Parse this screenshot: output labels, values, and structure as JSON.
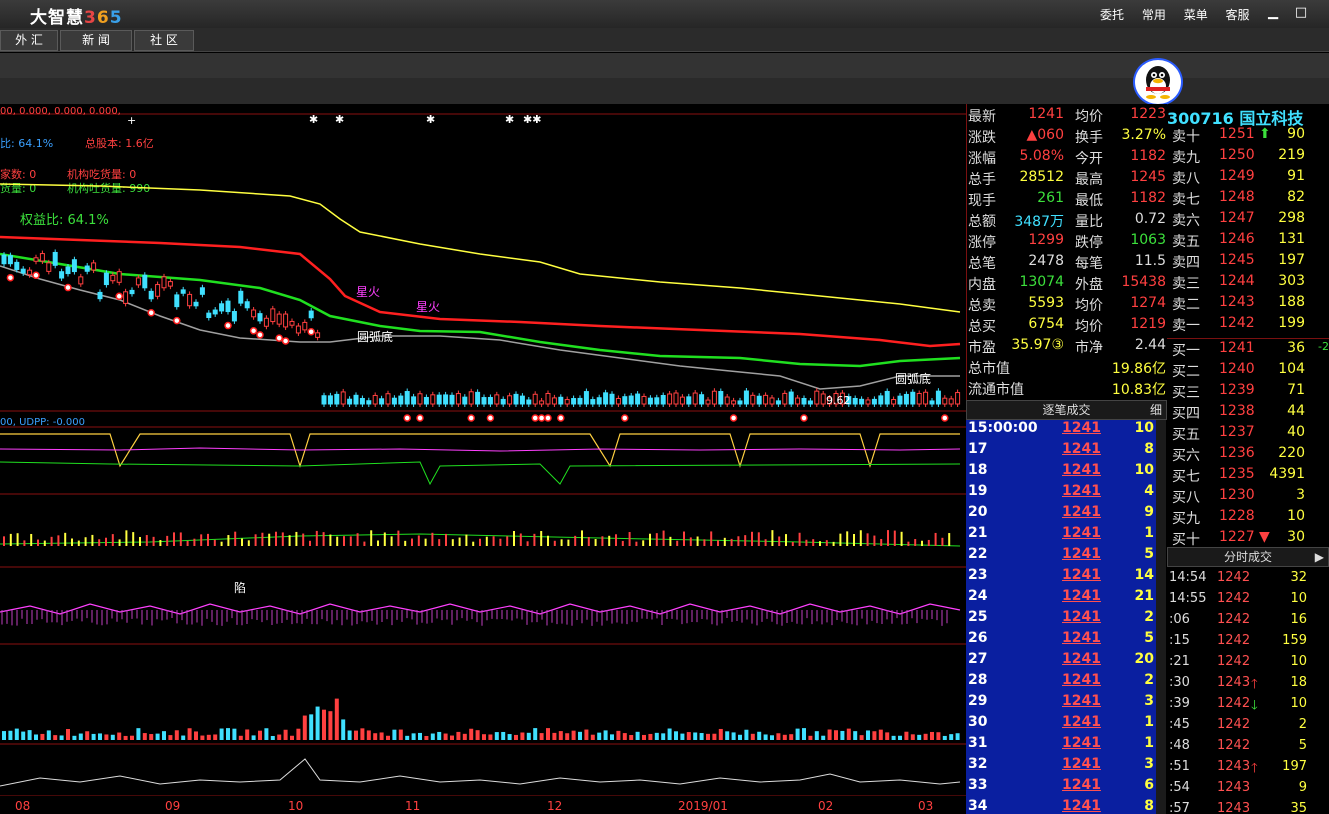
{
  "app": {
    "logo_main": "大智慧",
    "logo_3": "3",
    "logo_6": "6",
    "logo_5": "5"
  },
  "topmenu": [
    "委托",
    "常用",
    "菜单",
    "客服"
  ],
  "window": {
    "minimize": "▁",
    "maximize": "□"
  },
  "tabs": [
    "外 汇",
    "新 闻",
    "社 区"
  ],
  "chart": {
    "header_line": "00, 0.000, 0.000, 0.000,",
    "rate_left": "比: 64.1%",
    "total_equity": "总股本: 1.6亿",
    "count_left": "家数: 0",
    "inst_buy": "机构吃货量: 0",
    "bought_left": "货量: 0",
    "inst_sell": "机构吐货量: 990",
    "equity_ratio": "权益比: 64.1%",
    "star_fire": "星火",
    "arc_bottom": "圆弧底",
    "low_price": "9.62",
    "sub_header": "00, UDPP: -0.000",
    "trap": "陷",
    "months": [
      "08",
      "09",
      "10",
      "11",
      "12",
      "2019/01",
      "02",
      "03"
    ],
    "colors": {
      "yellow_line": "#ffff40",
      "red_line": "#ff2020",
      "green_line": "#20e020",
      "gray_line": "#a0a0a0"
    }
  },
  "quote": {
    "rows": [
      {
        "l": "最新",
        "v": "1241",
        "vc": "red",
        "l2": "均价",
        "v2": "1223",
        "v2c": "red"
      },
      {
        "l": "涨跌",
        "v": "▲060",
        "vc": "red",
        "l2": "换手",
        "v2": "3.27%",
        "v2c": "yel"
      },
      {
        "l": "涨幅",
        "v": "5.08%",
        "vc": "red",
        "l2": "今开",
        "v2": "1182",
        "v2c": "red"
      },
      {
        "l": "总手",
        "v": "28512",
        "vc": "yel",
        "l2": "最高",
        "v2": "1245",
        "v2c": "red"
      },
      {
        "l": "现手",
        "v": "261",
        "vc": "green",
        "l2": "最低",
        "v2": "1182",
        "v2c": "red"
      },
      {
        "l": "总额",
        "v": "3487万",
        "vc": "cyan",
        "l2": "量比",
        "v2": "0.72",
        "v2c": "white"
      },
      {
        "l": "涨停",
        "v": "1299",
        "vc": "red",
        "l2": "跌停",
        "v2": "1063",
        "v2c": "green"
      },
      {
        "l": "总笔",
        "v": "2478",
        "vc": "white",
        "l2": "每笔",
        "v2": "11.5",
        "v2c": "white"
      },
      {
        "l": "内盘",
        "v": "13074",
        "vc": "green",
        "l2": "外盘",
        "v2": "15438",
        "v2c": "red"
      },
      {
        "l": "总卖",
        "v": "5593",
        "vc": "yel",
        "l2": "均价",
        "v2": "1274",
        "v2c": "red"
      },
      {
        "l": "总买",
        "v": "6754",
        "vc": "yel",
        "l2": "均价",
        "v2": "1219",
        "v2c": "red"
      },
      {
        "l": "市盈",
        "v": "35.97③",
        "vc": "yel",
        "l2": "市净",
        "v2": "2.44",
        "v2c": "white"
      },
      {
        "l": "总市值",
        "v": "",
        "vc": "white",
        "l2": "",
        "v2": "19.86亿",
        "v2c": "yel"
      },
      {
        "l": "流通市值",
        "v": "",
        "vc": "white",
        "l2": "",
        "v2": "10.83亿",
        "v2c": "yel"
      }
    ]
  },
  "stock": {
    "code_name": "300716 国立科技"
  },
  "book": {
    "sell": [
      {
        "l": "卖十",
        "p": "1251",
        "q": "90",
        "arrow": "up"
      },
      {
        "l": "卖九",
        "p": "1250",
        "q": "219"
      },
      {
        "l": "卖八",
        "p": "1249",
        "q": "91"
      },
      {
        "l": "卖七",
        "p": "1248",
        "q": "82"
      },
      {
        "l": "卖六",
        "p": "1247",
        "q": "298"
      },
      {
        "l": "卖五",
        "p": "1246",
        "q": "131"
      },
      {
        "l": "卖四",
        "p": "1245",
        "q": "197"
      },
      {
        "l": "卖三",
        "p": "1244",
        "q": "303"
      },
      {
        "l": "卖二",
        "p": "1243",
        "q": "188"
      },
      {
        "l": "卖一",
        "p": "1242",
        "q": "199"
      }
    ],
    "buy": [
      {
        "l": "买一",
        "p": "1241",
        "q": "36",
        "extra": "-2"
      },
      {
        "l": "买二",
        "p": "1240",
        "q": "104"
      },
      {
        "l": "买三",
        "p": "1239",
        "q": "71"
      },
      {
        "l": "买四",
        "p": "1238",
        "q": "44"
      },
      {
        "l": "买五",
        "p": "1237",
        "q": "40"
      },
      {
        "l": "买六",
        "p": "1236",
        "q": "220"
      },
      {
        "l": "买七",
        "p": "1235",
        "q": "4391"
      },
      {
        "l": "买八",
        "p": "1230",
        "q": "3"
      },
      {
        "l": "买九",
        "p": "1228",
        "q": "10"
      },
      {
        "l": "买十",
        "p": "1227",
        "q": "30",
        "arrow": "down"
      }
    ]
  },
  "ticks": {
    "title": "逐笔成交",
    "detail_btn": "细",
    "rows": [
      {
        "t": "15:00:00",
        "p": "1241",
        "v": "10"
      },
      {
        "t": "17",
        "p": "1241",
        "v": "8"
      },
      {
        "t": "18",
        "p": "1241",
        "v": "10"
      },
      {
        "t": "19",
        "p": "1241",
        "v": "4"
      },
      {
        "t": "20",
        "p": "1241",
        "v": "9"
      },
      {
        "t": "21",
        "p": "1241",
        "v": "1"
      },
      {
        "t": "22",
        "p": "1241",
        "v": "5"
      },
      {
        "t": "23",
        "p": "1241",
        "v": "14"
      },
      {
        "t": "24",
        "p": "1241",
        "v": "21"
      },
      {
        "t": "25",
        "p": "1241",
        "v": "2"
      },
      {
        "t": "26",
        "p": "1241",
        "v": "5"
      },
      {
        "t": "27",
        "p": "1241",
        "v": "20"
      },
      {
        "t": "28",
        "p": "1241",
        "v": "2"
      },
      {
        "t": "29",
        "p": "1241",
        "v": "3"
      },
      {
        "t": "30",
        "p": "1241",
        "v": "1"
      },
      {
        "t": "31",
        "p": "1241",
        "v": "1"
      },
      {
        "t": "32",
        "p": "1241",
        "v": "3"
      },
      {
        "t": "33",
        "p": "1241",
        "v": "6"
      },
      {
        "t": "34",
        "p": "1241",
        "v": "8"
      }
    ]
  },
  "fenshi": {
    "title": "分时成交",
    "rows": [
      {
        "t": "14:54",
        "p": "1242",
        "v": "32",
        "a": ""
      },
      {
        "t": "14:55",
        "p": "1242",
        "v": "10",
        "a": ""
      },
      {
        "t": ":06",
        "p": "1242",
        "v": "16",
        "a": ""
      },
      {
        "t": ":15",
        "p": "1242",
        "v": "159",
        "a": ""
      },
      {
        "t": ":21",
        "p": "1242",
        "v": "10",
        "a": ""
      },
      {
        "t": ":30",
        "p": "1243",
        "v": "18",
        "a": "up"
      },
      {
        "t": ":39",
        "p": "1242",
        "v": "10",
        "a": "down"
      },
      {
        "t": ":45",
        "p": "1242",
        "v": "2",
        "a": ""
      },
      {
        "t": ":48",
        "p": "1242",
        "v": "5",
        "a": ""
      },
      {
        "t": ":51",
        "p": "1243",
        "v": "197",
        "a": "up"
      },
      {
        "t": ":54",
        "p": "1243",
        "v": "9",
        "a": ""
      },
      {
        "t": ":57",
        "p": "1243",
        "v": "35",
        "a": ""
      }
    ]
  }
}
